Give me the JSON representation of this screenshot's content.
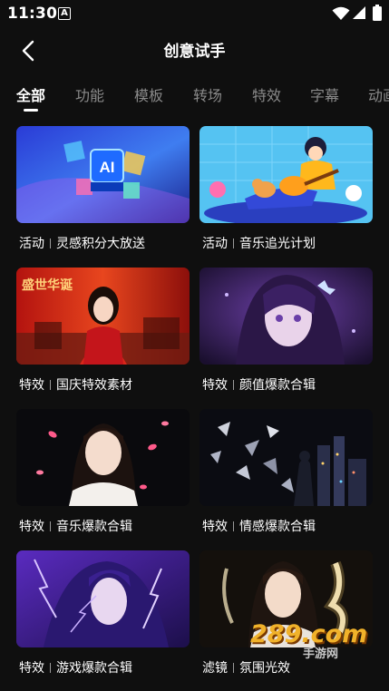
{
  "status_bar": {
    "time": "11:30",
    "notification_letter": "A"
  },
  "header": {
    "title": "创意试手"
  },
  "tabs": [
    {
      "label": "全部",
      "active": true
    },
    {
      "label": "功能"
    },
    {
      "label": "模板"
    },
    {
      "label": "转场"
    },
    {
      "label": "特效"
    },
    {
      "label": "字幕"
    },
    {
      "label": "动画"
    }
  ],
  "cards": [
    {
      "category": "活动",
      "title": "灵感积分大放送",
      "thumb": "ai-cube"
    },
    {
      "category": "活动",
      "title": "音乐追光计划",
      "thumb": "guitar-illustration"
    },
    {
      "category": "特效",
      "title": "国庆特效素材",
      "thumb": "national-day-portrait"
    },
    {
      "category": "特效",
      "title": "颜值爆款合辑",
      "thumb": "anime-girl-purple"
    },
    {
      "category": "特效",
      "title": "音乐爆款合辑",
      "thumb": "portrait-petals"
    },
    {
      "category": "特效",
      "title": "情感爆款合辑",
      "thumb": "shatter-city"
    },
    {
      "category": "特效",
      "title": "游戏爆款合辑",
      "thumb": "game-heroine-lightning"
    },
    {
      "category": "滤镜",
      "title": "氛围光效",
      "thumb": "portrait-glow"
    }
  ],
  "thumb_texts": {
    "ai_cube": "AI",
    "national_day": "盛世华诞"
  },
  "watermark": {
    "main": "289.com",
    "sub": "手游网"
  },
  "colors": {
    "background": "#0f0f0f",
    "tab_inactive": "#8a8a8a",
    "watermark": "#f1b22a"
  }
}
